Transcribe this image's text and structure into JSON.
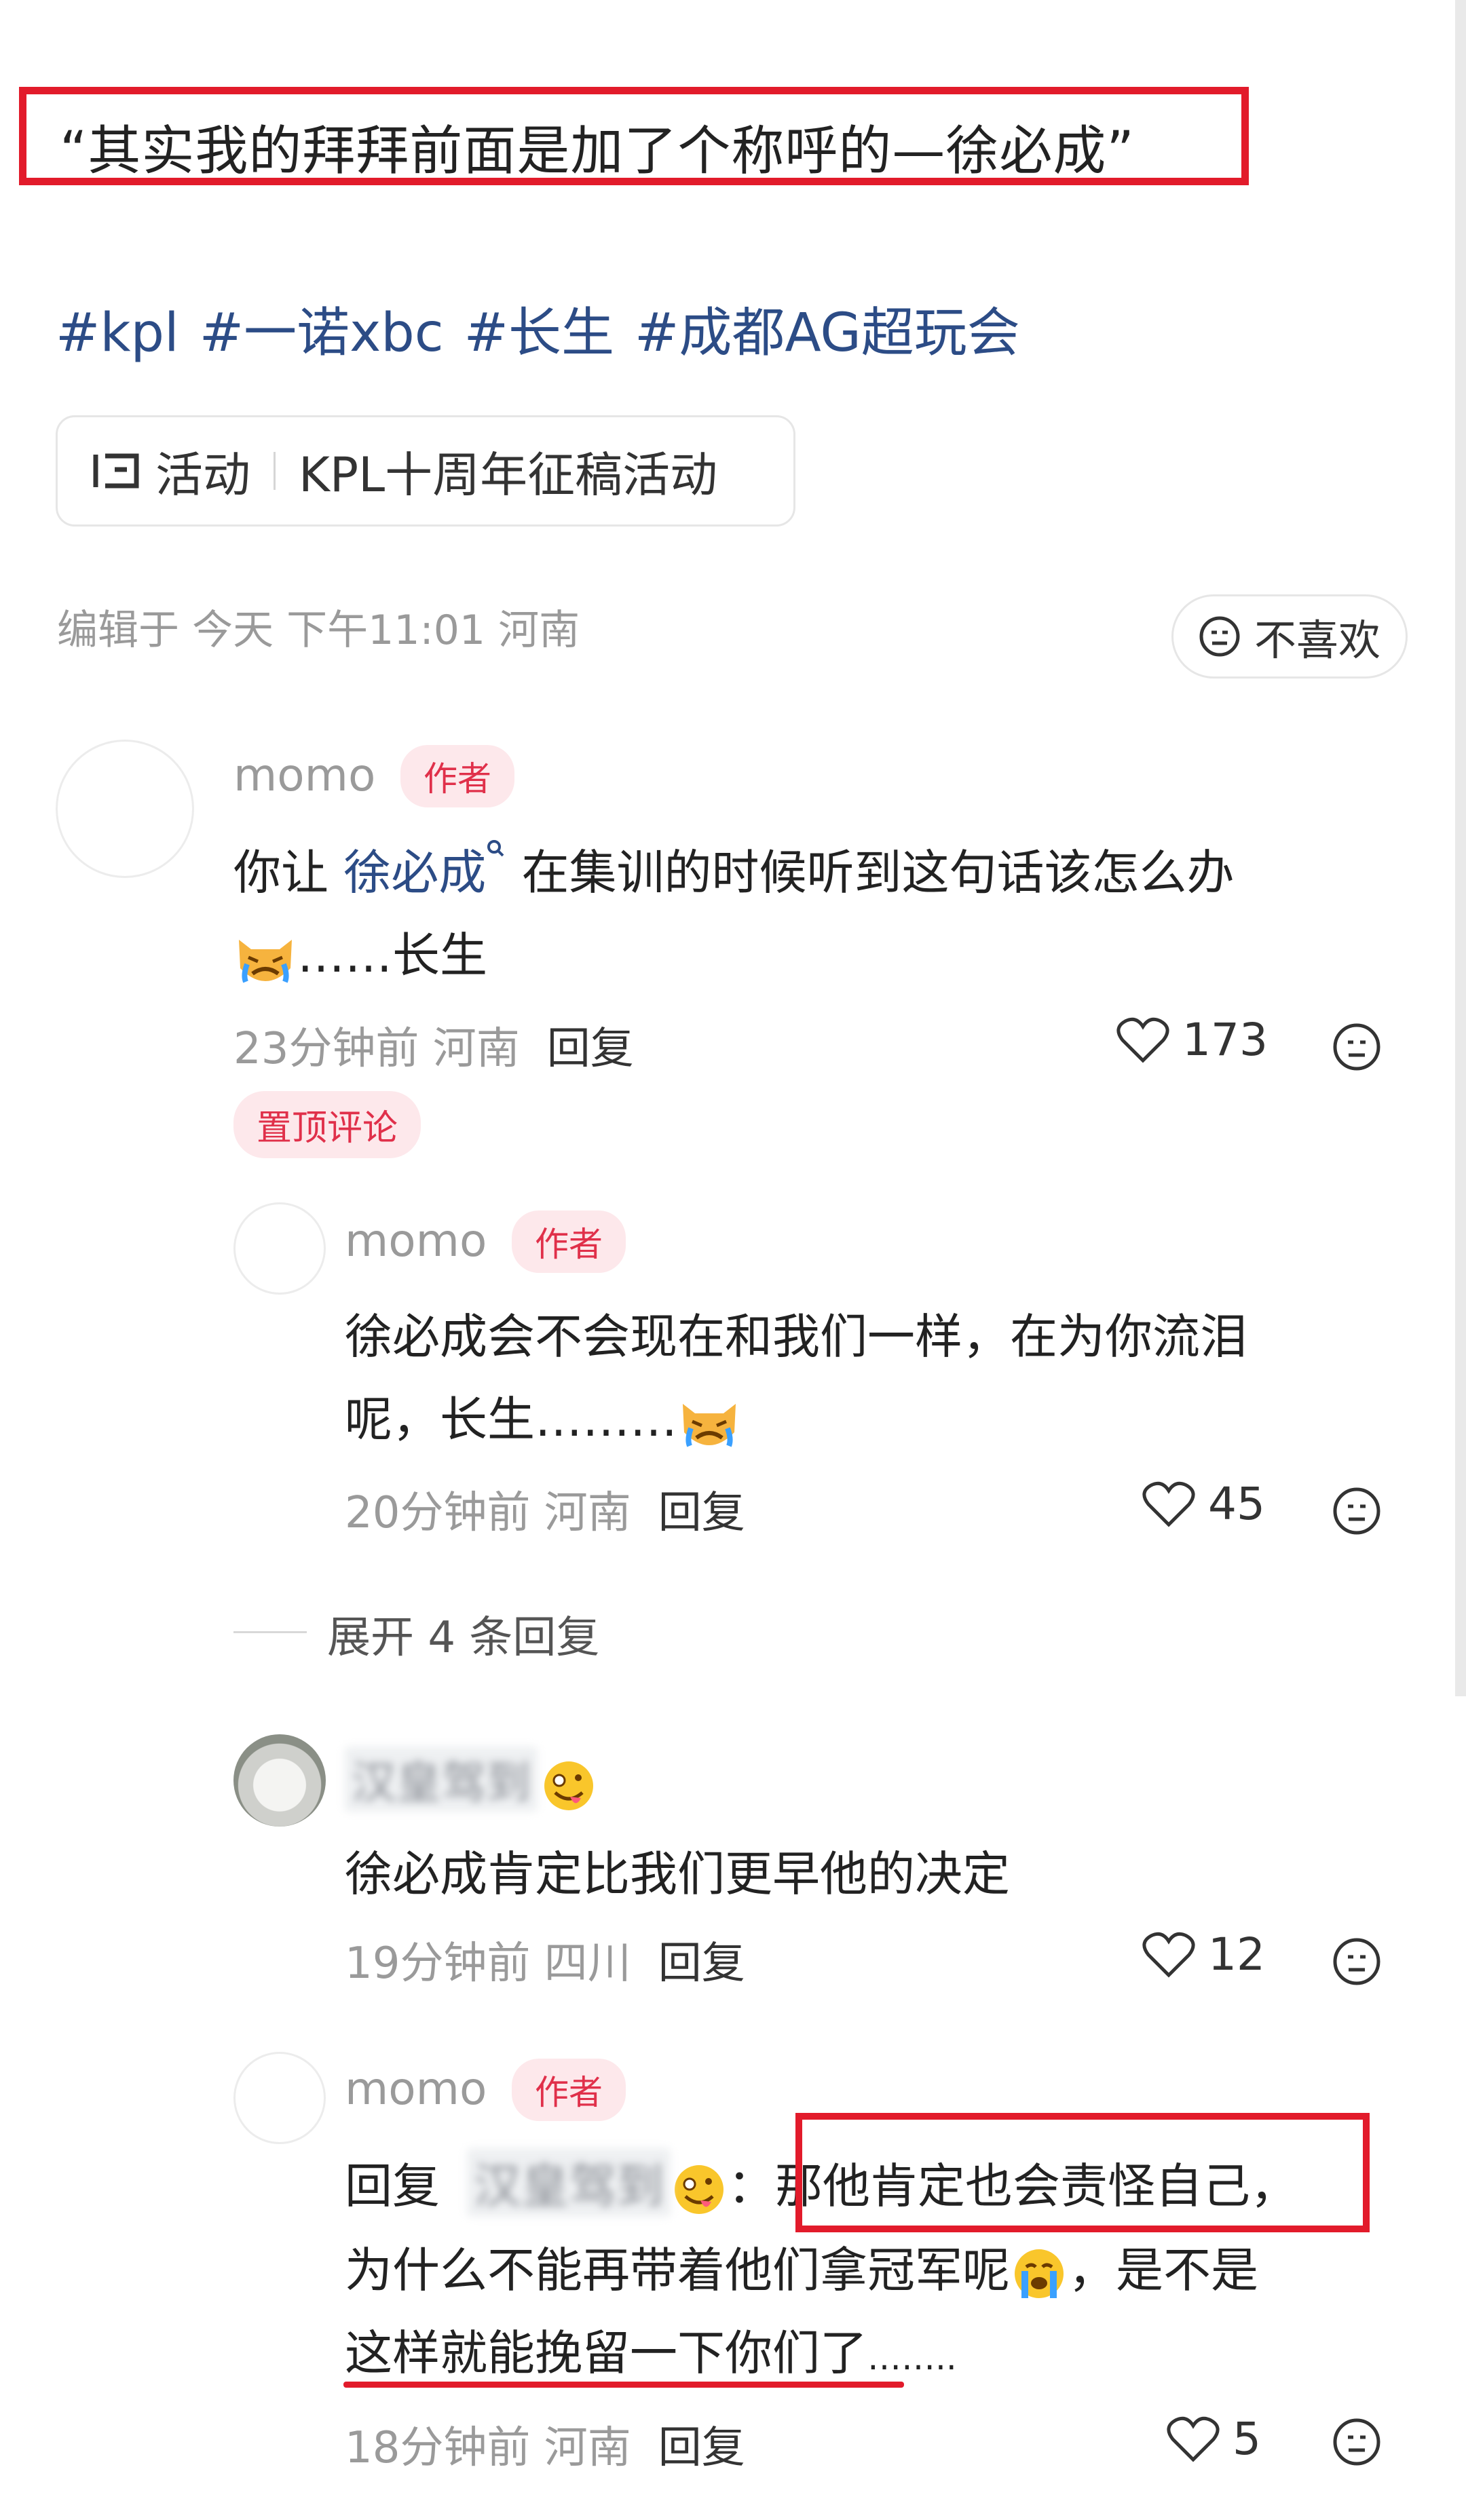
{
  "post": {
    "title": "“其实我的拜拜前面是加了个称呼的—徐必成”",
    "tags": [
      "#kpl",
      "#一诺xbc",
      "#长生",
      "#成都AG超玩会"
    ],
    "activity": {
      "label": "活动",
      "name": "KPL十周年征稿活动"
    },
    "meta": "编辑于 今天 下午11:01 河南",
    "dislike_label": "不喜欢"
  },
  "comments": [
    {
      "author": "momo",
      "badge": "作者",
      "text_prefix": "你让 ",
      "mention": "徐必成",
      "text_suffix": " 在集训的时候听到这句话该怎么办",
      "text_line2": "……长生",
      "time": "23分钟前 河南",
      "reply_label": "回复",
      "likes": "173",
      "pinned_label": "置顶评论"
    }
  ],
  "replies": [
    {
      "author": "momo",
      "badge": "作者",
      "line1": "徐必成会不会现在和我们一样，在为你流泪",
      "line2": "呢，长生………",
      "time": "20分钟前 河南",
      "reply_label": "回复",
      "likes": "45"
    },
    {
      "author": "汉皇驾到",
      "text": "徐必成肯定比我们更早他的决定",
      "time": "19分钟前 四川",
      "reply_label": "回复",
      "likes": "12"
    },
    {
      "author": "momo",
      "badge": "作者",
      "reply_prefix": "回复",
      "reply_to": "汉皇驾到",
      "line1": "那他肯定也会责怪自己，",
      "line2a": "为什么不能再带着他们拿冠军呢",
      "line2b": "，是不是",
      "line3a": "这样就能挽留一下你们了",
      "line3b": "……..",
      "time": "18分钟前 河南",
      "reply_label": "回复",
      "likes": "5"
    }
  ],
  "expand_label": "展开 4 条回复",
  "colors": {
    "highlight": "#e21b2b",
    "link": "#2c4c86",
    "badge_bg": "#fde8eb",
    "badge_fg": "#e0304a"
  }
}
